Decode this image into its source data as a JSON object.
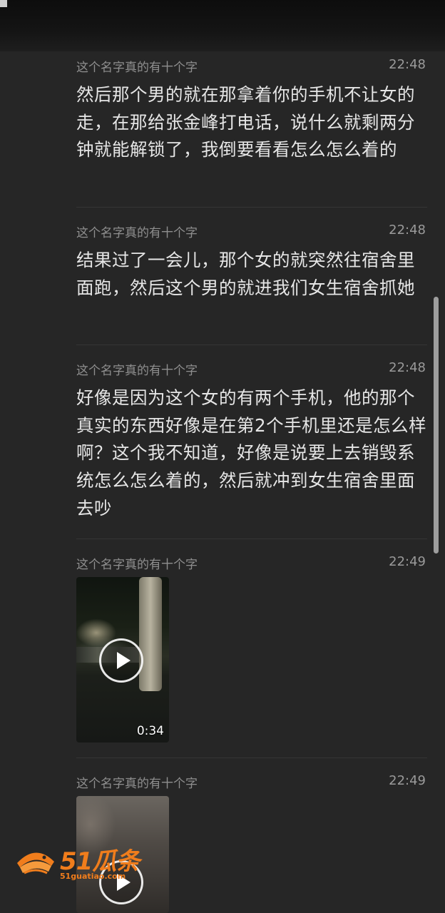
{
  "messages": [
    {
      "sender": "这个名字真的有十个字",
      "time": "22:48",
      "text": "然后那个男的就在那拿着你的手机不让女的走，在那给张金峰打电话，说什么就剩两分钟就能解锁了，我倒要看看怎么怎么着的"
    },
    {
      "sender": "这个名字真的有十个字",
      "time": "22:48",
      "text": "结果过了一会儿，那个女的就突然往宿舍里面跑，然后这个男的就进我们女生宿舍抓她"
    },
    {
      "sender": "这个名字真的有十个字",
      "time": "22:48",
      "text": "好像是因为这个女的有两个手机，他的那个真实的东西好像是在第2个手机里还是怎么样啊？这个我不知道，好像是说要上去销毁系统怎么怎么着的，然后就冲到女生宿舍里面去吵"
    },
    {
      "sender": "这个名字真的有十个字",
      "time": "22:49",
      "video": {
        "duration": "0:34",
        "icon": "play-icon"
      }
    },
    {
      "sender": "这个名字真的有十个字",
      "time": "22:49",
      "video": {
        "icon": "play-icon"
      }
    }
  ],
  "watermark": {
    "brand": "51瓜条",
    "domain": "51guatiao.com",
    "color": "#f07d1c"
  }
}
